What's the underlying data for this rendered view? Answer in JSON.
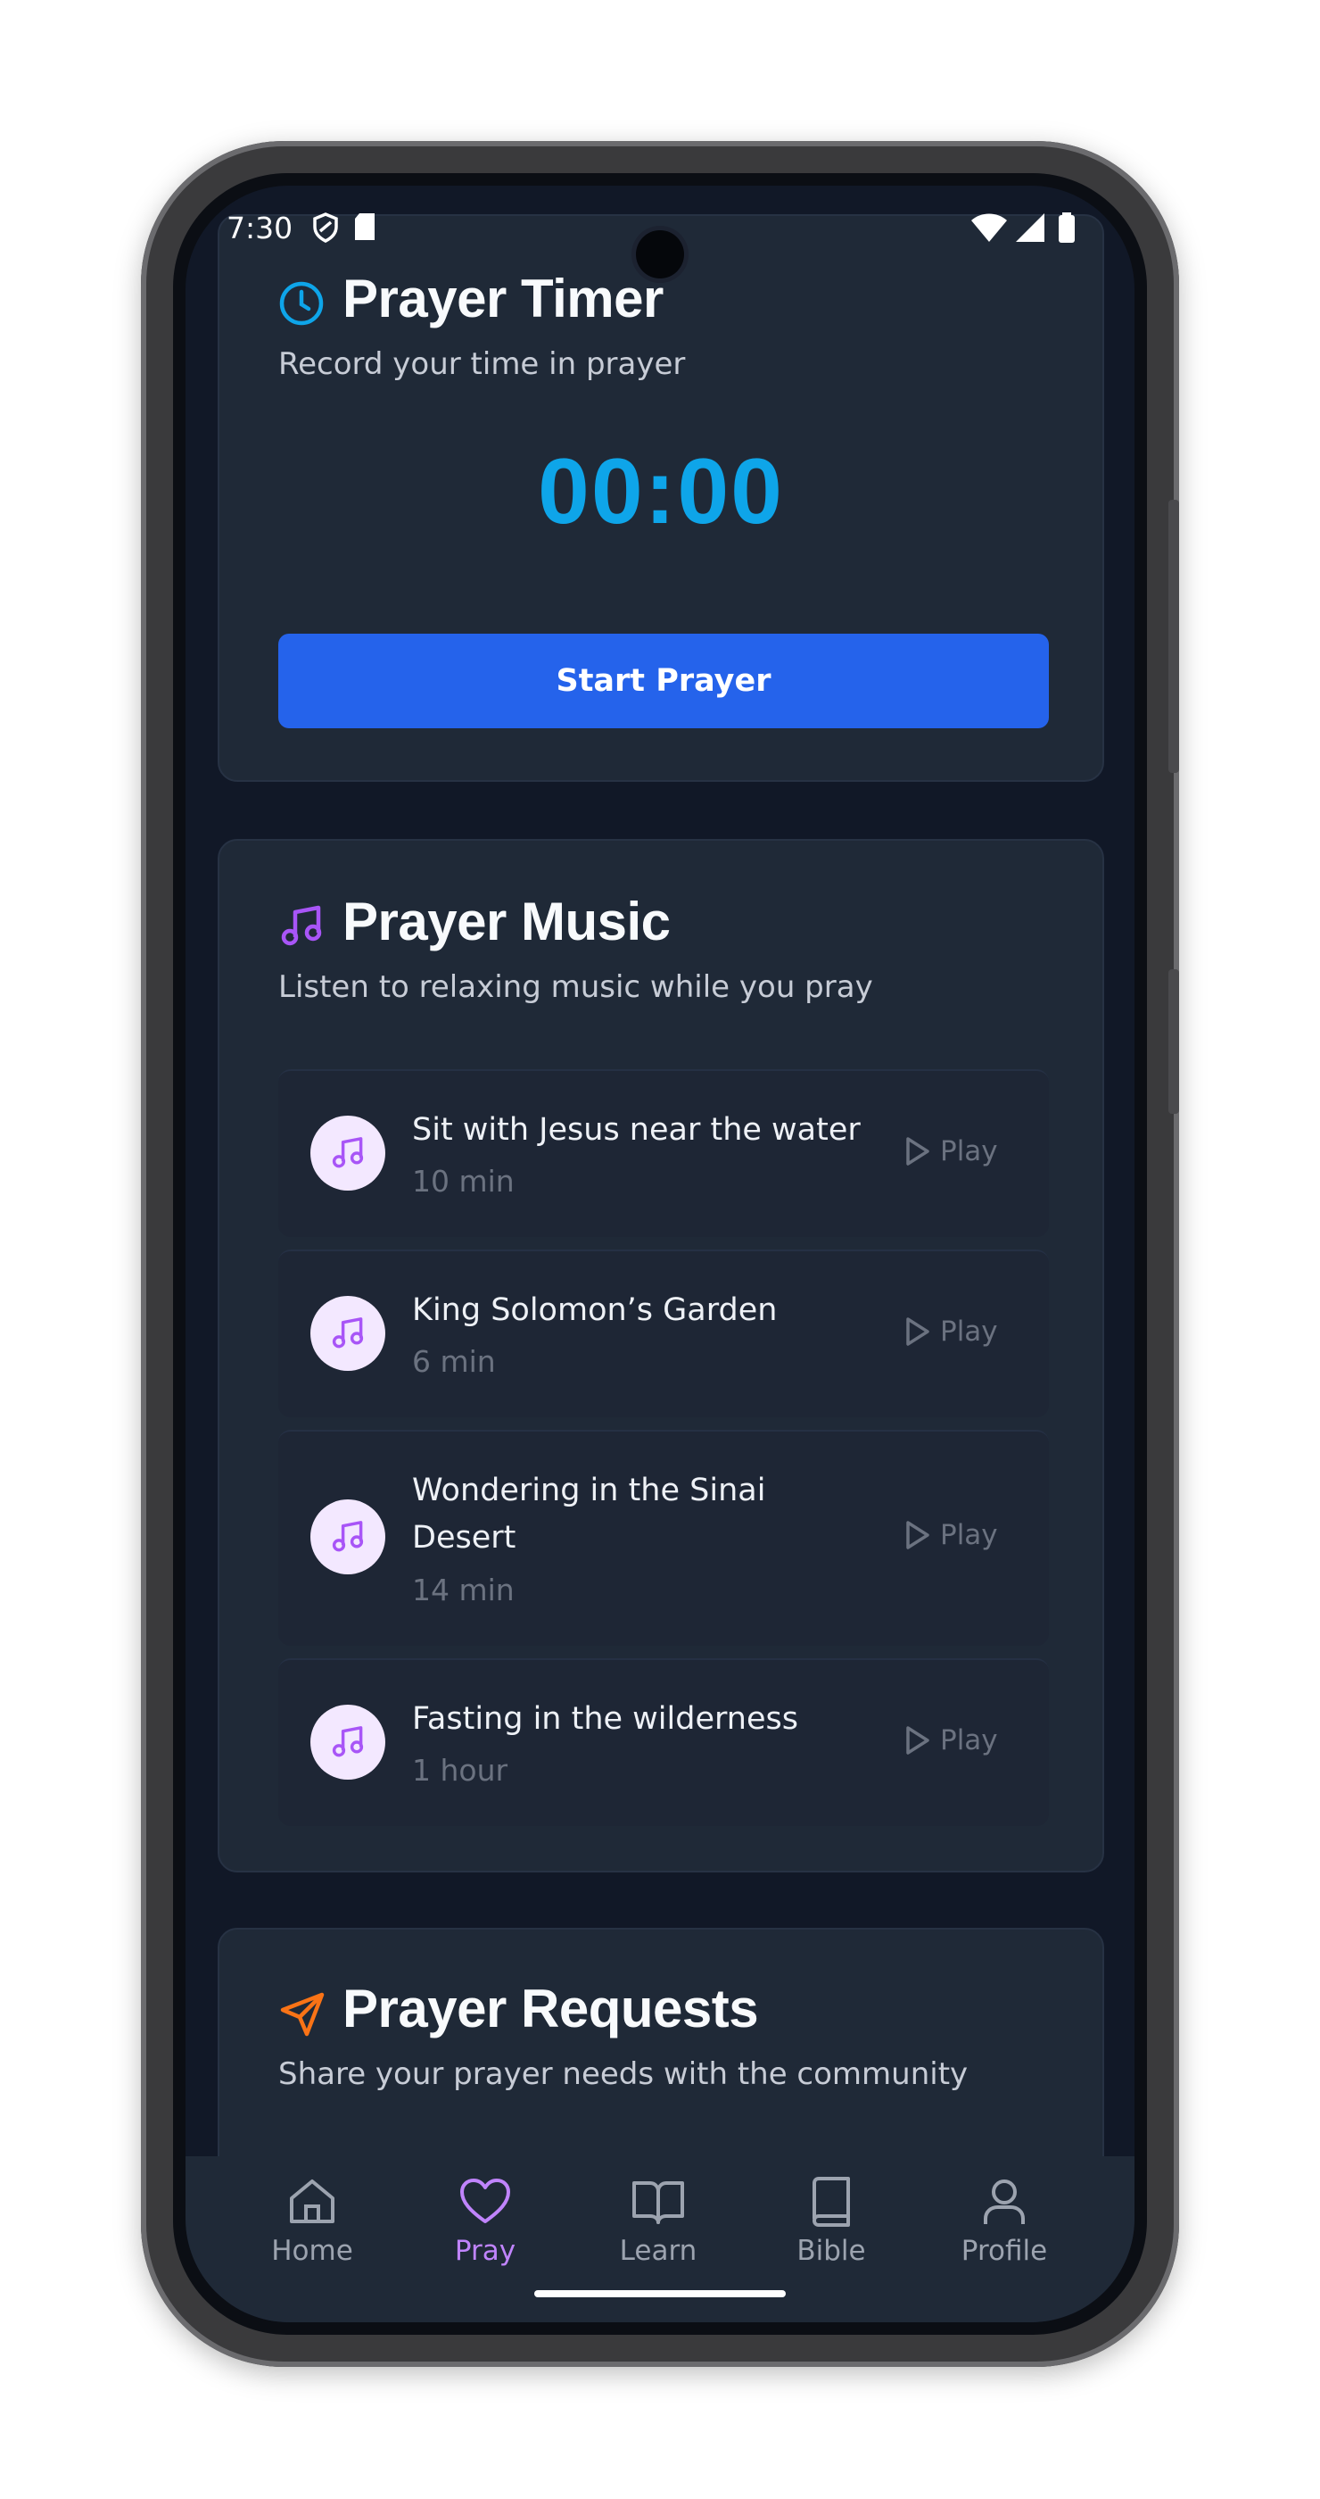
{
  "status_bar": {
    "time": "7:30"
  },
  "prayer_timer": {
    "title": "Prayer Timer",
    "subtitle": "Record your time in prayer",
    "timer_value": "00:00",
    "start_button": "Start Prayer",
    "icon": "clock-icon",
    "accent": "#0ea5e9"
  },
  "prayer_music": {
    "title": "Prayer Music",
    "subtitle": "Listen to relaxing music while you pray",
    "icon": "music-note-icon",
    "accent": "#a855f7",
    "tracks": [
      {
        "title": "Sit with Jesus near the water",
        "duration": "10 min",
        "play_label": "Play"
      },
      {
        "title": "King Solomon’s Garden",
        "duration": "6 min",
        "play_label": "Play"
      },
      {
        "title": "Wondering in the Sinai Desert",
        "duration": "14 min",
        "play_label": "Play"
      },
      {
        "title": "Fasting in the wilderness",
        "duration": "1 hour",
        "play_label": "Play"
      }
    ]
  },
  "prayer_requests": {
    "title": "Prayer Requests",
    "subtitle": "Share your prayer needs with the community",
    "icon": "send-icon",
    "accent": "#f97316"
  },
  "bottom_nav": {
    "active": "Pray",
    "active_color": "#c084fc",
    "items": [
      {
        "label": "Home",
        "icon": "home-icon"
      },
      {
        "label": "Pray",
        "icon": "heart-icon"
      },
      {
        "label": "Learn",
        "icon": "open-book-icon"
      },
      {
        "label": "Bible",
        "icon": "book-icon"
      },
      {
        "label": "Profile",
        "icon": "user-icon"
      }
    ]
  }
}
